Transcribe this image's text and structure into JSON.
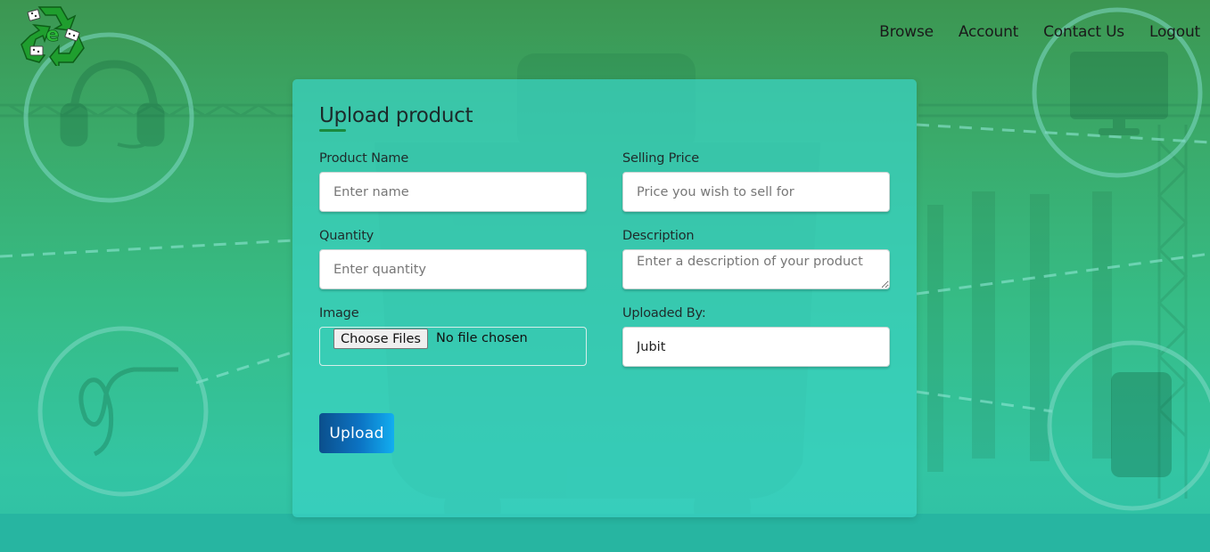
{
  "logo": {
    "letter": "e"
  },
  "nav": {
    "items": [
      {
        "label": "Browse"
      },
      {
        "label": "Account"
      },
      {
        "label": "Contact Us"
      },
      {
        "label": "Logout"
      }
    ]
  },
  "form": {
    "title": "Upload product",
    "product_name": {
      "label": "Product Name",
      "placeholder": "Enter name",
      "value": ""
    },
    "selling_price": {
      "label": "Selling Price",
      "placeholder": "Price you wish to sell for",
      "value": ""
    },
    "quantity": {
      "label": "Quantity",
      "placeholder": "Enter quantity",
      "value": ""
    },
    "description": {
      "label": "Description",
      "placeholder": "Enter a description of your product",
      "value": ""
    },
    "image": {
      "label": "Image",
      "button_label": "Choose Files",
      "status": "No file chosen"
    },
    "uploaded_by": {
      "label": "Uploaded By:",
      "value": "Jubit"
    },
    "submit_label": "Upload"
  },
  "colors": {
    "accent_underline": "#1a8a3e",
    "button_gradient_start": "#0b4f8c",
    "button_gradient_end": "#12aef0"
  }
}
